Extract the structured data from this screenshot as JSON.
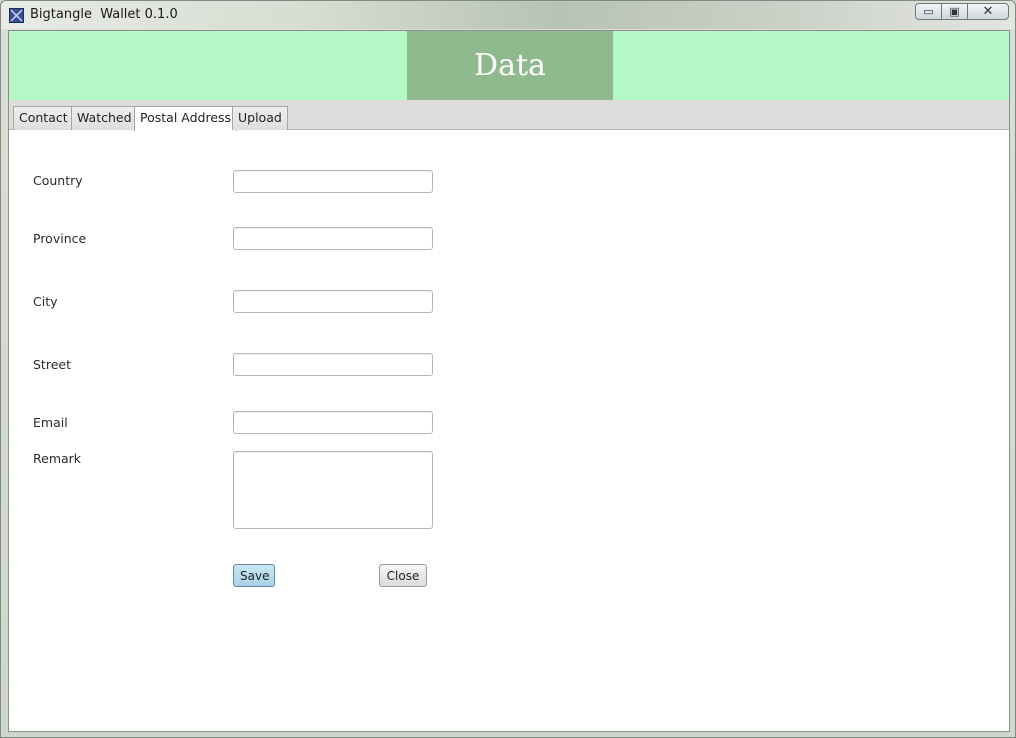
{
  "window": {
    "title": "Bigtangle  Wallet 0.1.0",
    "controls": {
      "minimize": "▭",
      "maximize": "▣",
      "close": "✕"
    }
  },
  "header": {
    "title": "Data"
  },
  "tabs": [
    {
      "label": "Contact",
      "selected": false
    },
    {
      "label": "Watched",
      "selected": false
    },
    {
      "label": "Postal Address",
      "selected": true
    },
    {
      "label": "Upload",
      "selected": false
    }
  ],
  "form": {
    "country": {
      "label": "Country",
      "value": ""
    },
    "province": {
      "label": "Province",
      "value": ""
    },
    "city": {
      "label": "City",
      "value": ""
    },
    "street": {
      "label": "Street",
      "value": ""
    },
    "email": {
      "label": "Email",
      "value": ""
    },
    "remark": {
      "label": "Remark",
      "value": ""
    }
  },
  "buttons": {
    "save": "Save",
    "close": "Close"
  },
  "colors": {
    "header_band": "#b4f8c6",
    "header_title_box": "#8fba8d",
    "save_button": "#a8d2e8"
  }
}
